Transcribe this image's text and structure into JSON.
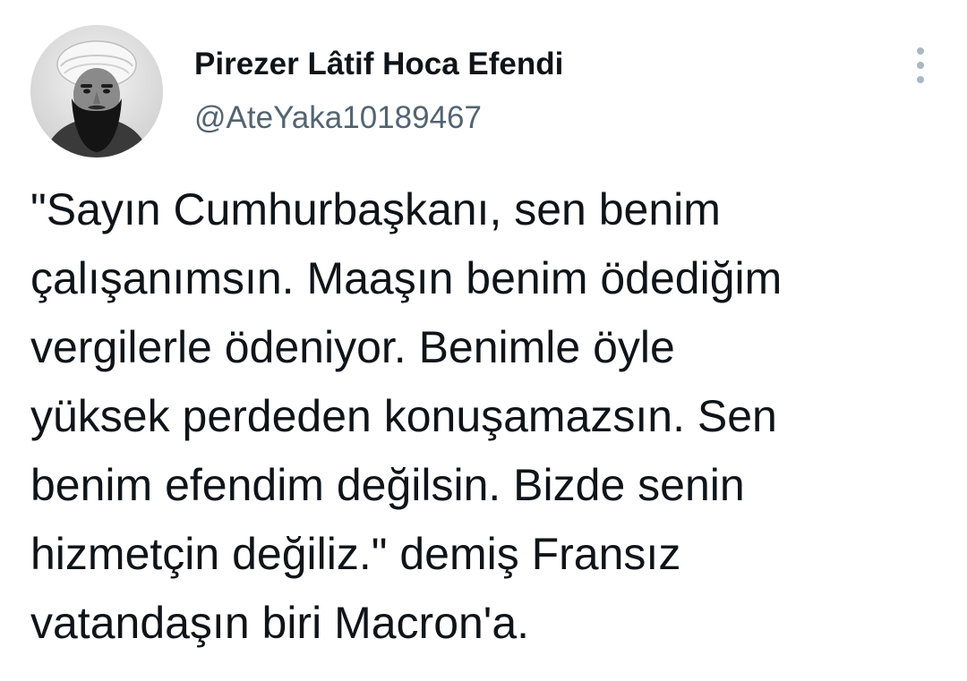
{
  "tweet": {
    "author": {
      "display_name": "Pirezer Lâtif Hoca Efendi",
      "handle": "@AteYaka10189467",
      "avatar_icon": "bearded-man-portrait-avatar"
    },
    "more_icon": "vertical-ellipsis-icon",
    "text": "\"Sayın Cumhurbaşkanı, sen benim\nçalışanımsın. Maaşın benim ödediğim\nvergilerle ödeniyor. Benimle öyle\nyüksek perdeden konuşamazsın. Sen\nbenim efendim değilsin. Bizde senin\nhizmetçin değiliz.\" demiş Fransız\nvatandaşın biri Macron'a."
  },
  "colors": {
    "text_primary": "#0f1419",
    "text_secondary": "#536471",
    "icon_gray": "#aab8c2",
    "background": "#ffffff"
  }
}
